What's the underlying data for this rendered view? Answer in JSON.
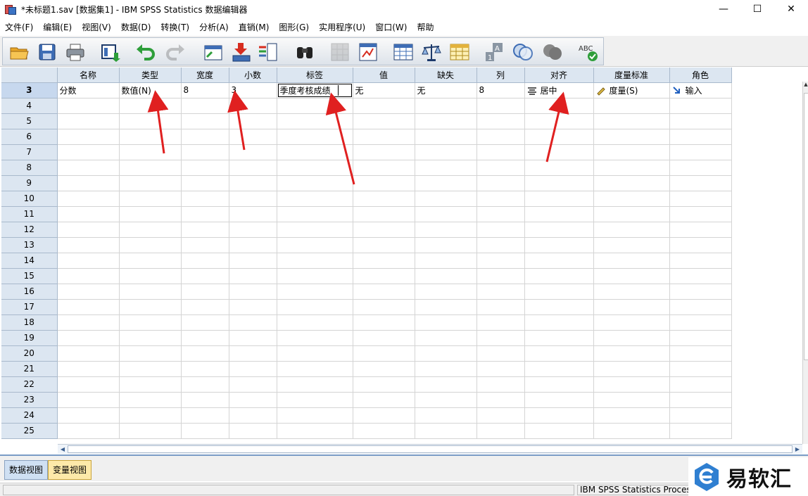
{
  "window": {
    "title": "*未标题1.sav [数据集1] - IBM SPSS Statistics 数据编辑器",
    "minimize": "—",
    "maximize": "☐",
    "close": "✕"
  },
  "menu": [
    "文件(F)",
    "编辑(E)",
    "视图(V)",
    "数据(D)",
    "转换(T)",
    "分析(A)",
    "直销(M)",
    "图形(G)",
    "实用程序(U)",
    "窗口(W)",
    "帮助"
  ],
  "toolbar": {
    "icons": [
      "open-folder-icon",
      "save-icon",
      "print-icon",
      "recall-dialog-icon",
      "undo-icon",
      "redo-icon",
      "goto-case-icon",
      "goto-variable-icon",
      "variables-icon",
      "find-icon",
      "insert-cases-icon",
      "insert-variable-icon",
      "split-file-icon",
      "weight-cases-icon",
      "select-cases-icon",
      "value-labels-icon",
      "use-variable-sets-icon",
      "show-all-variables-icon",
      "spell-check-icon"
    ],
    "spell_label": "ABC"
  },
  "grid": {
    "columns": [
      "名称",
      "类型",
      "宽度",
      "小数",
      "标签",
      "值",
      "缺失",
      "列",
      "对齐",
      "度量标准",
      "角色"
    ],
    "active_row": {
      "number": "3",
      "cells": [
        "分数",
        "数值(N)",
        "8",
        "3",
        "季度考核成绩",
        "无",
        "无",
        "8",
        "居中",
        "度量(S)",
        "输入"
      ]
    },
    "empty_rows": [
      "4",
      "5",
      "6",
      "7",
      "8",
      "9",
      "10",
      "11",
      "12",
      "13",
      "14",
      "15",
      "16",
      "17",
      "18",
      "19",
      "20",
      "21",
      "22",
      "23",
      "24",
      "25"
    ]
  },
  "tabs": {
    "data_view": "数据视图",
    "variable_view": "变量视图"
  },
  "status": {
    "processor": "IBM SPSS Statistics Processor"
  },
  "watermark": {
    "text": "易软汇"
  },
  "colors": {
    "header_bg": "#dce6f1",
    "active_tab": "#fde9a9",
    "arrow": "#e02020"
  }
}
